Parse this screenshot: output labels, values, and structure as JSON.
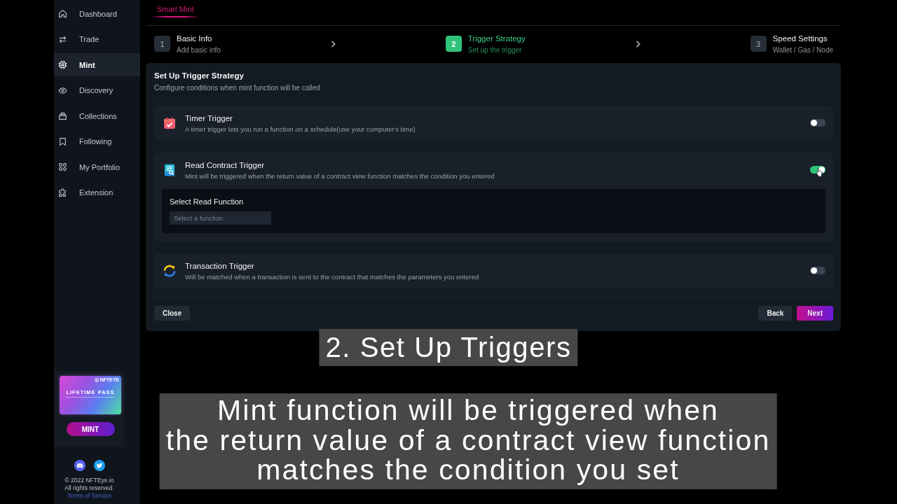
{
  "sidebar": {
    "items": [
      {
        "kind": "home",
        "label": "Dashboard",
        "selected": false
      },
      {
        "kind": "swap",
        "label": "Trade",
        "selected": false
      },
      {
        "kind": "chip",
        "label": "Mint",
        "selected": true
      },
      {
        "kind": "eye",
        "label": "Discovery",
        "selected": false
      },
      {
        "kind": "stack",
        "label": "Collections",
        "selected": false
      },
      {
        "kind": "bookmark",
        "label": "Following",
        "selected": false
      },
      {
        "kind": "grid",
        "label": "My Portfolio",
        "selected": false
      },
      {
        "kind": "puzzle",
        "label": "Extension",
        "selected": false
      }
    ],
    "promo": {
      "brand": "NFTEYE",
      "card_title": "LIFETIME PASS",
      "button": "MINT"
    },
    "social": [
      {
        "kind": "discord"
      },
      {
        "kind": "twitter"
      }
    ],
    "footer": {
      "copyright": "© 2022 NFTEye.io",
      "rights": "All rights reserved.",
      "link": "Terms of Service"
    }
  },
  "page_tab": {
    "label": "Smart Mint",
    "selected": true
  },
  "steps": [
    {
      "number": "1",
      "title": "Basic Info",
      "subtitle": "Add basic info",
      "selected": false
    },
    {
      "number": "2",
      "title": "Trigger Strategy",
      "subtitle": "Set up the trigger",
      "selected": true
    },
    {
      "number": "3",
      "title": "Speed Settings",
      "subtitle": "Wallet / Gas / Node",
      "selected": false
    }
  ],
  "panel": {
    "title": "Set Up Trigger Strategy",
    "subtitle": "Configure conditions when mint function will be called",
    "triggers": [
      {
        "kind": "timer",
        "title": "Timer Trigger",
        "description": "A timer trigger lets you run a function on a schedule(use your computer's time)",
        "on": false
      },
      {
        "kind": "read_contract",
        "title": "Read Contract Trigger",
        "description": "Mint will be triggered when the return value of a contract view function matches the condition you entered",
        "on": true,
        "field": {
          "label": "Select Read Function",
          "placeholder": "Select a function"
        }
      },
      {
        "kind": "transaction",
        "title": "Transaction Trigger",
        "description": "Will be matched when a transaction is sent to the contract that matches the parameters you entered",
        "on": false
      }
    ],
    "buttons": {
      "close": "Close",
      "back": "Back",
      "next": "Next"
    }
  },
  "captions": {
    "heading": "2. Set Up Triggers",
    "subtitle_lines": [
      "Mint function will be triggered when",
      "the return value of a contract view function",
      "matches the condition you set"
    ]
  }
}
